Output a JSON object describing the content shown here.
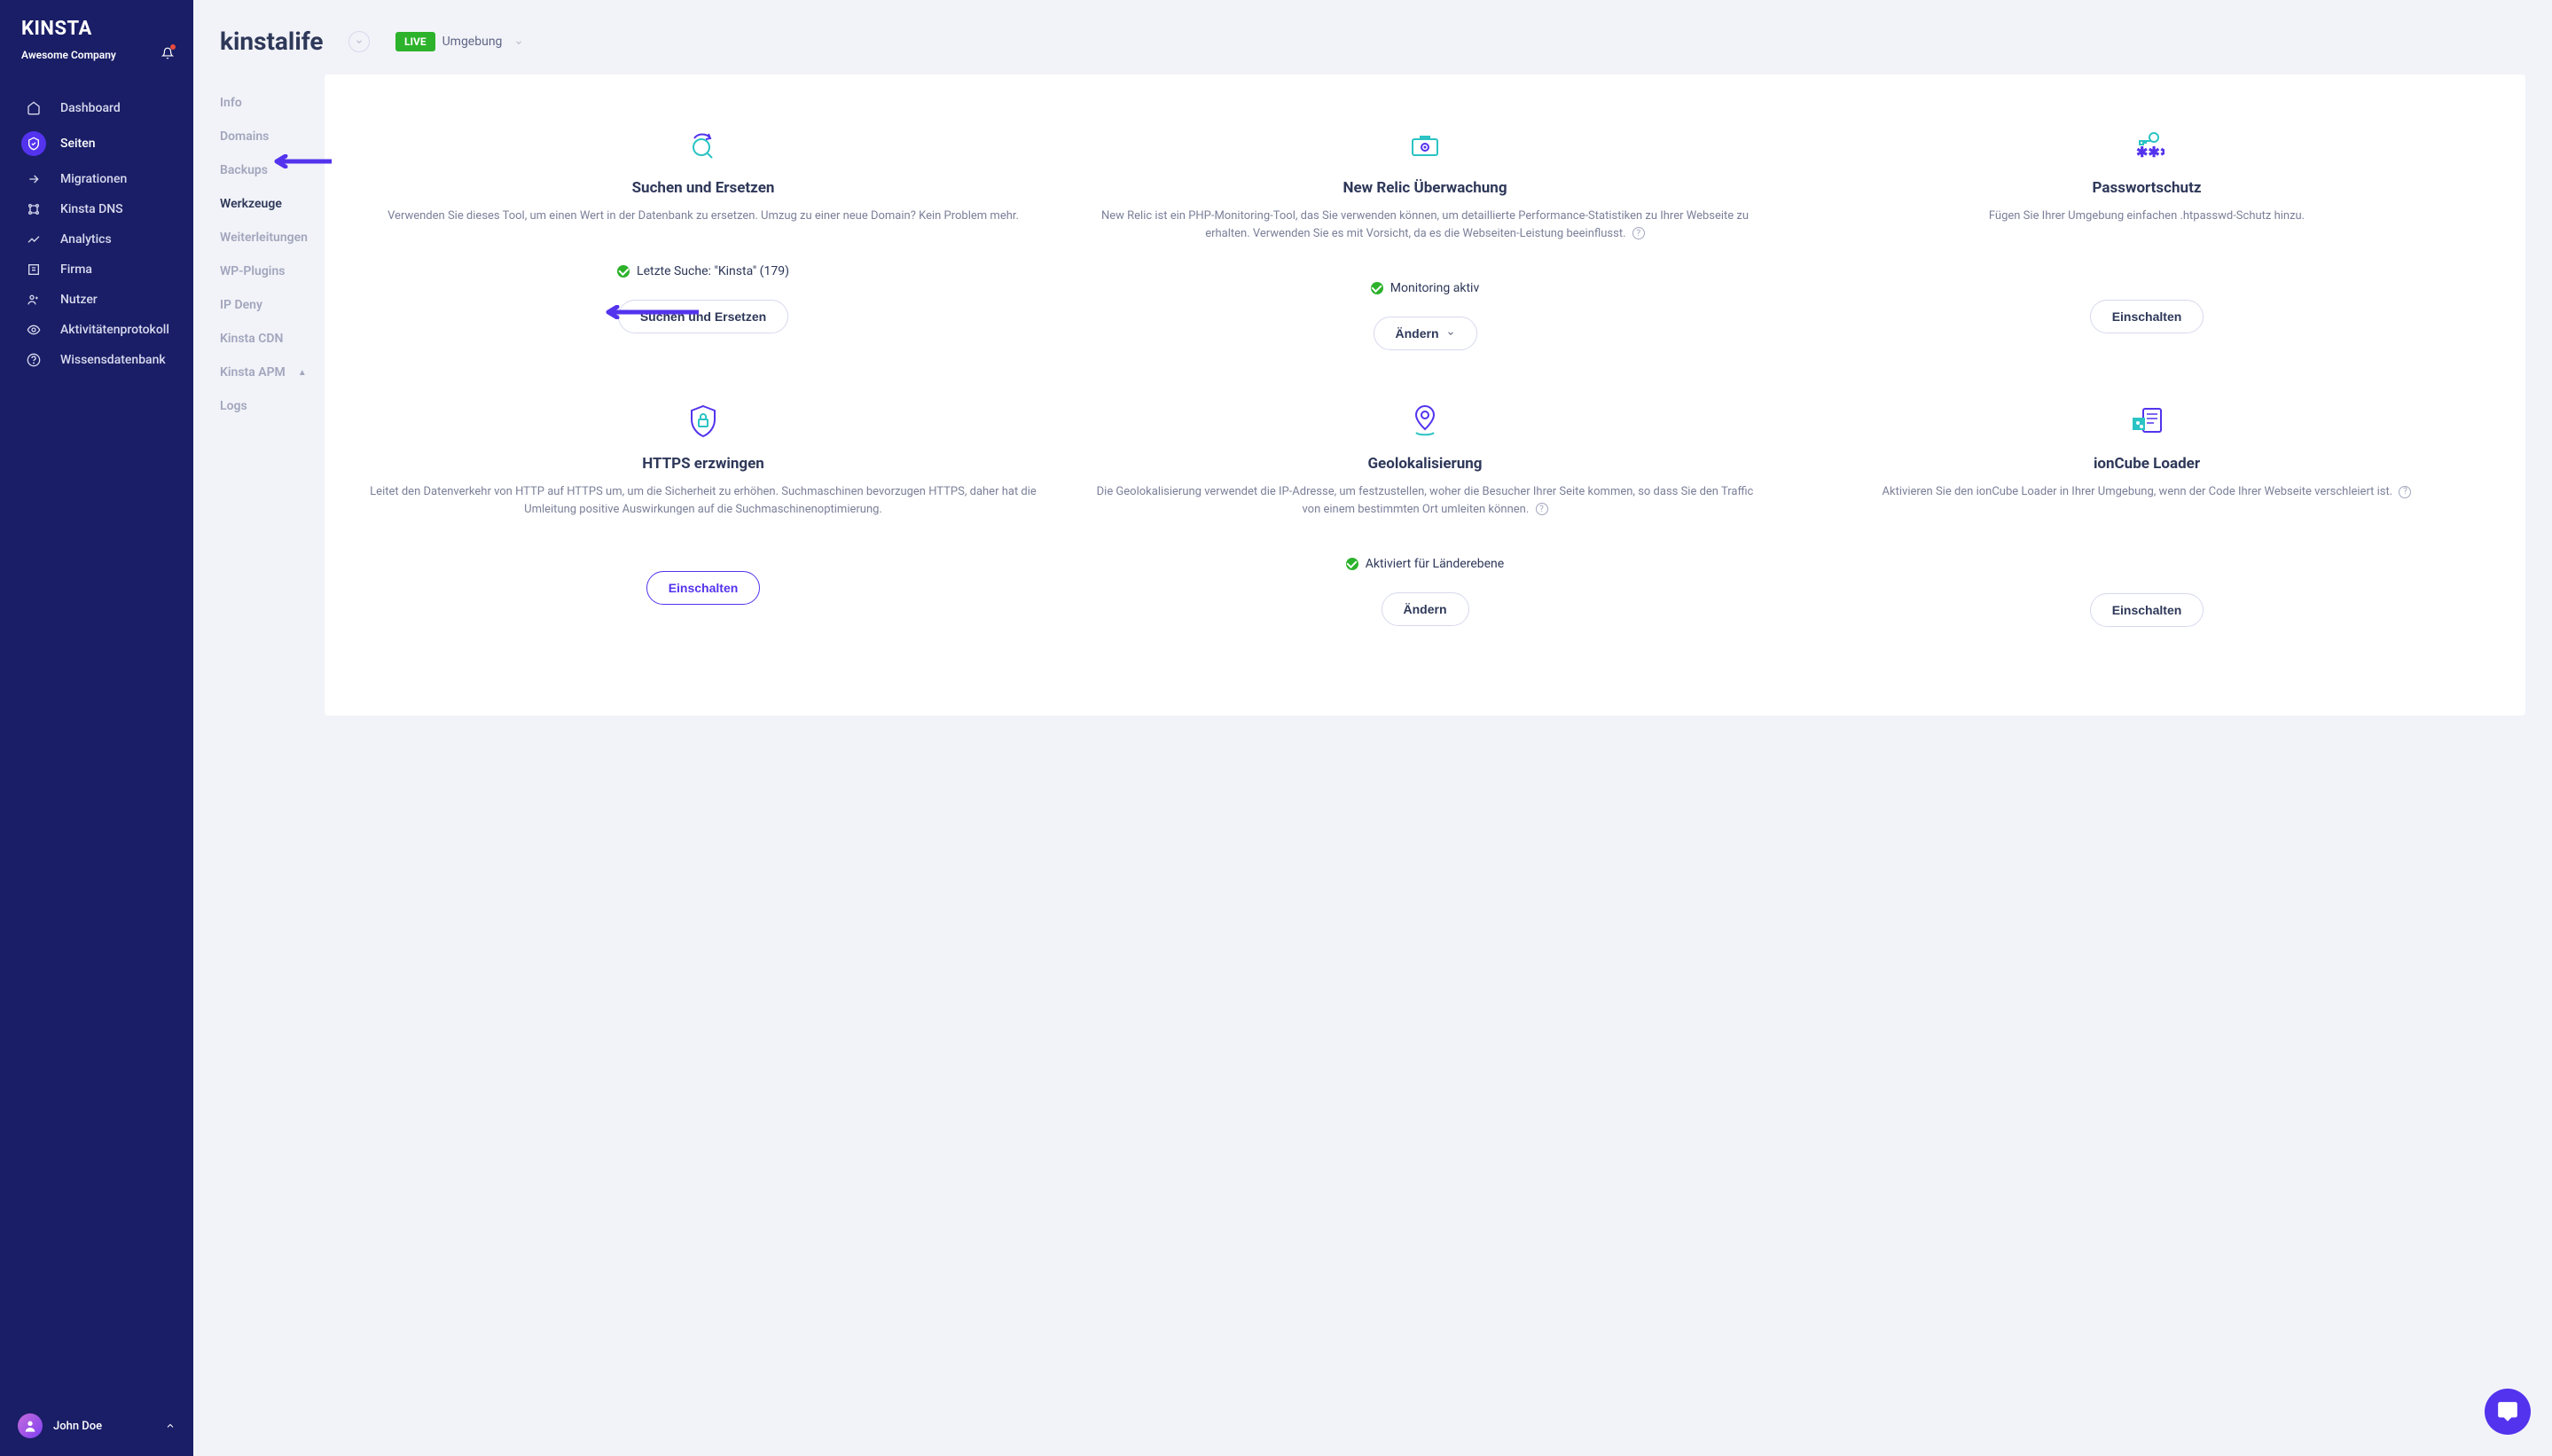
{
  "brand": "KINSTA",
  "company": "Awesome Company",
  "nav": {
    "dashboard": "Dashboard",
    "sites": "Seiten",
    "migrations": "Migrationen",
    "dns": "Kinsta DNS",
    "analytics": "Analytics",
    "company_item": "Firma",
    "users": "Nutzer",
    "activity": "Aktivitätenprotokoll",
    "kb": "Wissensdatenbank"
  },
  "user": {
    "name": "John Doe"
  },
  "site": {
    "name": "kinstalife"
  },
  "env": {
    "badge": "LIVE",
    "label": "Umgebung"
  },
  "subnav": {
    "info": "Info",
    "domains": "Domains",
    "backups": "Backups",
    "tools": "Werkzeuge",
    "redirects": "Weiterleitungen",
    "plugins": "WP-Plugins",
    "ipdeny": "IP Deny",
    "cdn": "Kinsta CDN",
    "apm": "Kinsta APM",
    "logs": "Logs"
  },
  "cards": {
    "search": {
      "title": "Suchen und Ersetzen",
      "desc": "Verwenden Sie dieses Tool, um einen Wert in der Datenbank zu ersetzen. Umzug zu einer neue Domain? Kein Problem mehr.",
      "status": "Letzte Suche: \"Kinsta\" (179)",
      "btn": "Suchen und Ersetzen"
    },
    "newrelic": {
      "title": "New Relic Überwachung",
      "desc": "New Relic ist ein PHP-Monitoring-Tool, das Sie verwenden können, um detaillierte Performance-Statistiken zu Ihrer Webseite zu erhalten. Verwenden Sie es mit Vorsicht, da es die Webseiten-Leistung beeinflusst.",
      "status": "Monitoring aktiv",
      "btn": "Ändern"
    },
    "password": {
      "title": "Passwortschutz",
      "desc": "Fügen Sie Ihrer Umgebung einfachen .htpasswd-Schutz hinzu.",
      "btn": "Einschalten"
    },
    "https": {
      "title": "HTTPS erzwingen",
      "desc": "Leitet den Datenverkehr von HTTP auf HTTPS um, um die Sicherheit zu erhöhen. Suchmaschinen bevorzugen HTTPS, daher hat die Umleitung positive Auswirkungen auf die Suchmaschinenoptimierung.",
      "btn": "Einschalten"
    },
    "geo": {
      "title": "Geolokalisierung",
      "desc": "Die Geolokalisierung verwendet die IP-Adresse, um festzustellen, woher die Besucher Ihrer Seite kommen, so dass Sie den Traffic von einem bestimmten Ort umleiten können.",
      "status": "Aktiviert für Länderebene",
      "btn": "Ändern"
    },
    "ioncube": {
      "title": "ionCube Loader",
      "desc": "Aktivieren Sie den ionCube Loader in Ihrer Umgebung, wenn der Code Ihrer Webseite verschleiert ist.",
      "btn": "Einschalten"
    }
  }
}
